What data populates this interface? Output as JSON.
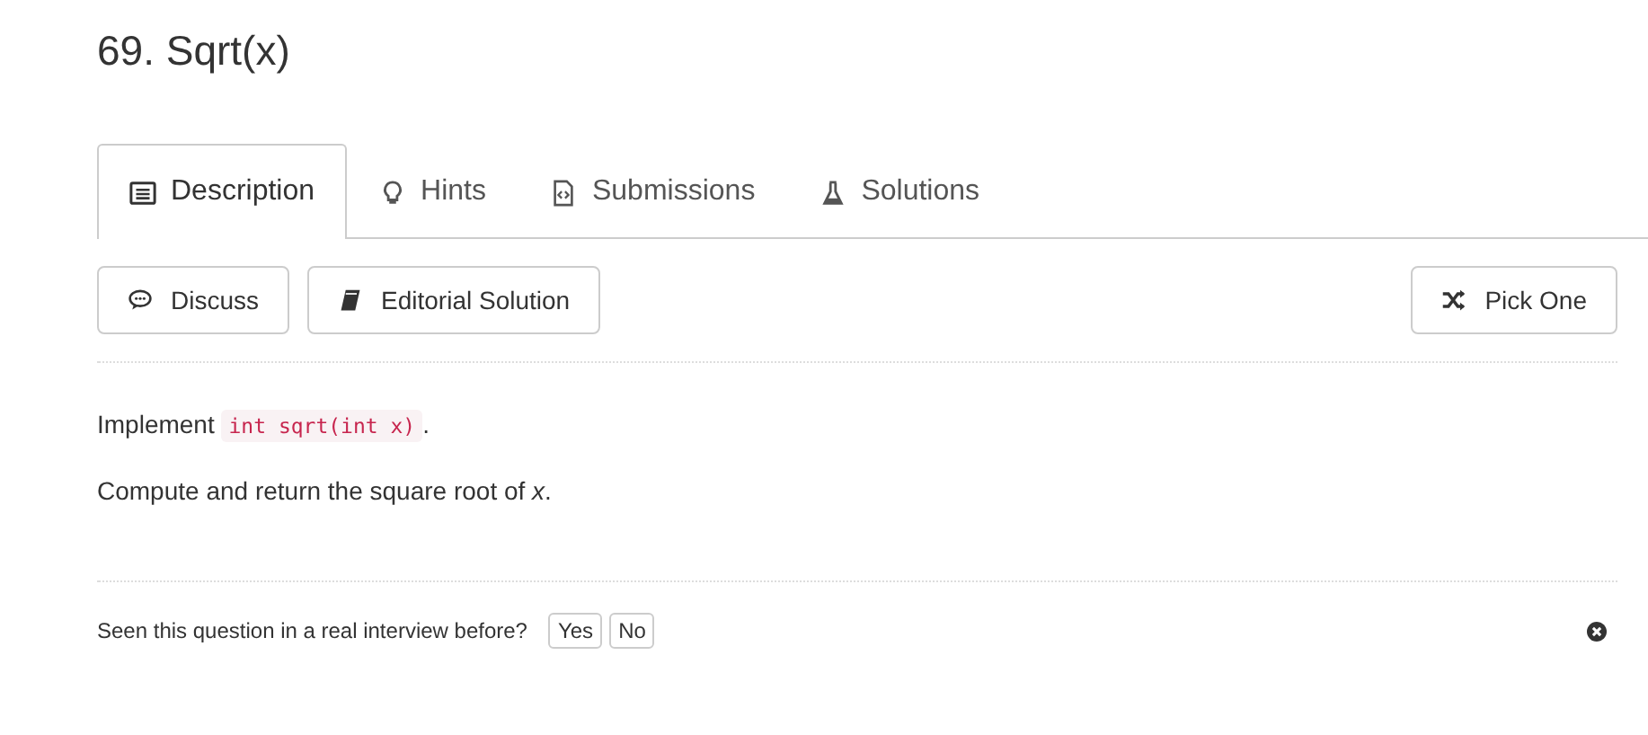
{
  "title": "69. Sqrt(x)",
  "tabs": [
    {
      "label": "Description",
      "kind": "list",
      "selected": true
    },
    {
      "label": "Hints",
      "kind": "bulb",
      "selected": false
    },
    {
      "label": "Submissions",
      "kind": "file",
      "selected": false
    },
    {
      "label": "Solutions",
      "kind": "flask",
      "selected": false
    }
  ],
  "actions": [
    {
      "label": "Discuss",
      "kind": "chat"
    },
    {
      "label": "Editorial Solution",
      "kind": "book"
    }
  ],
  "pick_button": {
    "label": "Pick One",
    "kind": "shuffle"
  },
  "description": [
    [
      {
        "kind": "text",
        "text": "Implement "
      },
      {
        "kind": "code",
        "text": "int sqrt(int x)"
      },
      {
        "kind": "text",
        "text": "."
      }
    ],
    [
      {
        "kind": "text",
        "text": "Compute and return the square root of *x*."
      }
    ]
  ],
  "feedback": {
    "question": "Seen this question in a real interview before?",
    "answers": [
      "Yes",
      "No"
    ]
  }
}
